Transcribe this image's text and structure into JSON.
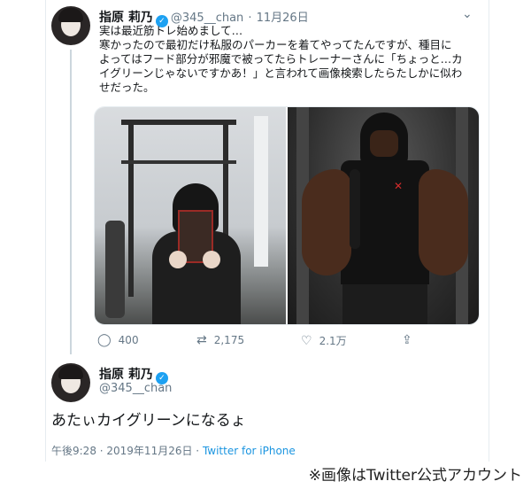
{
  "tweet": {
    "display_name": "指原 莉乃",
    "handle": "@345__chan",
    "date_sep": "·",
    "date": "11月26日",
    "lines": [
      "実は最近筋トレ始めまして…",
      "寒かったので最初だけ私服のパーカーを着てやってたんですが、種目に",
      "よってはフード部分が邪魔で被ってたらトレーナーさんに「ちょっと…カ",
      "イグリーンじゃないですかあ！」と言われて画像検索したらたしかに似わ",
      "せだった。"
    ],
    "actions": {
      "reply_count": "400",
      "retweet_count": "2,175",
      "like_count": "2.1万"
    }
  },
  "reply": {
    "display_name": "指原 莉乃",
    "handle": "@345__chan",
    "text": "あたぃカイグリーンになるょ",
    "time": "午後9:28 · 2019年11月26日 ·",
    "app": "Twitter for iPhone"
  },
  "credit": "※画像はTwitter公式アカウント",
  "colors": {
    "verified_badge": "#1da1f2",
    "link": "#1b95e0",
    "muted": "#657786"
  },
  "icons": {
    "reply": "speech-bubble-icon",
    "retweet": "retweet-icon",
    "like": "heart-icon",
    "share": "share-icon",
    "verified": "verified-badge-icon",
    "more": "chevron-down-icon"
  }
}
